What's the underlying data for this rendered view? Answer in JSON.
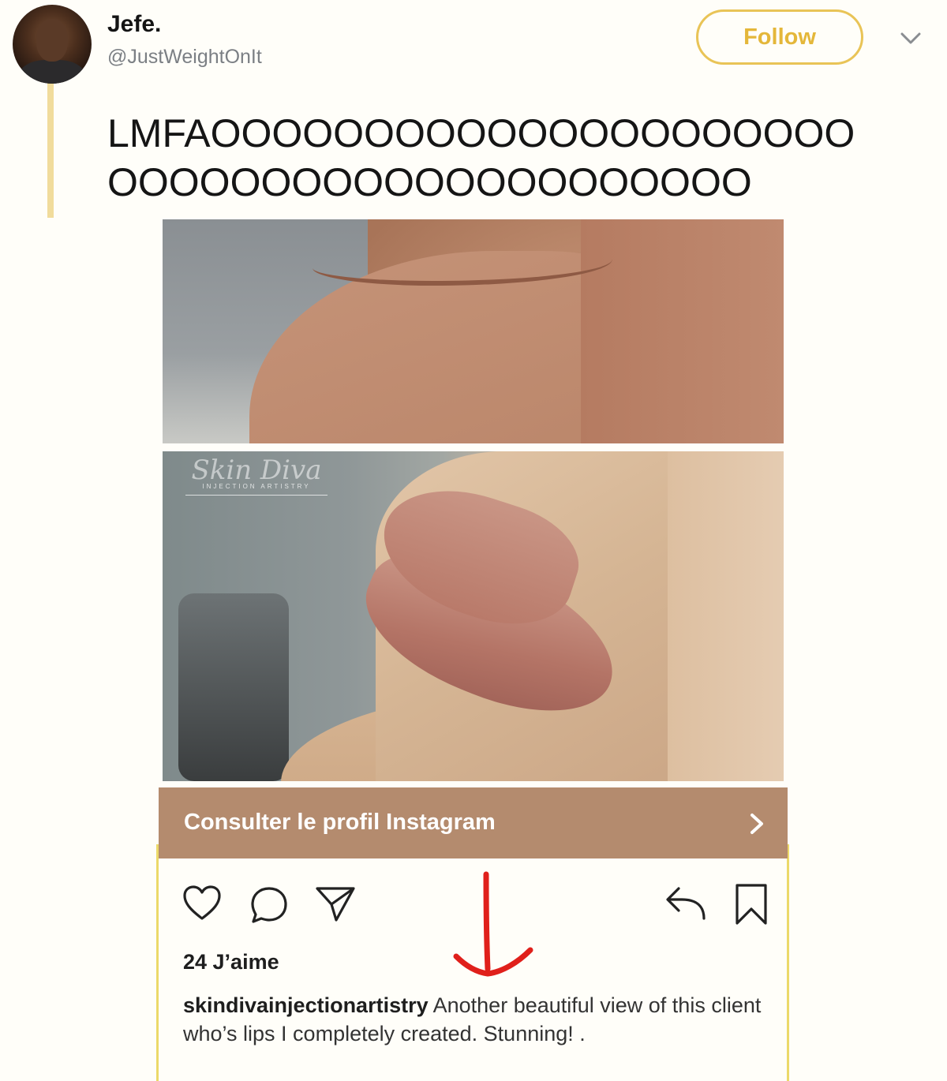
{
  "tweet": {
    "display_name": "Jefe.",
    "handle": "@JustWeightOnIt",
    "follow_label": "Follow",
    "text_line_1": "LMFAOOOOOOOOOOOOOOOOOOOOO",
    "text_line_2": "OOOOOOOOOOOOOOOOOOOOO"
  },
  "embed": {
    "profile_link_label": "Consulter le profil Instagram",
    "likes": "24 J’aime",
    "caption_user": "skindivainjectionartistry",
    "caption_text": " Another beautiful view of this client who’s lips I completely created. Stunning! .",
    "watermark_script": "Skin Diva",
    "watermark_caps": "INJECTION ARTISTRY"
  },
  "colors": {
    "follow_accent": "#e9c457",
    "thread_line": "#f1dc9c",
    "instagram_bar": "#b48b6e",
    "card_border": "#ecd96a",
    "annotation_arrow": "#e0201b"
  },
  "icons": [
    "chevron-down-icon",
    "heart-icon",
    "comment-icon",
    "share-icon",
    "reply-icon",
    "bookmark-icon",
    "chevron-right-icon",
    "red-arrow-annotation"
  ]
}
